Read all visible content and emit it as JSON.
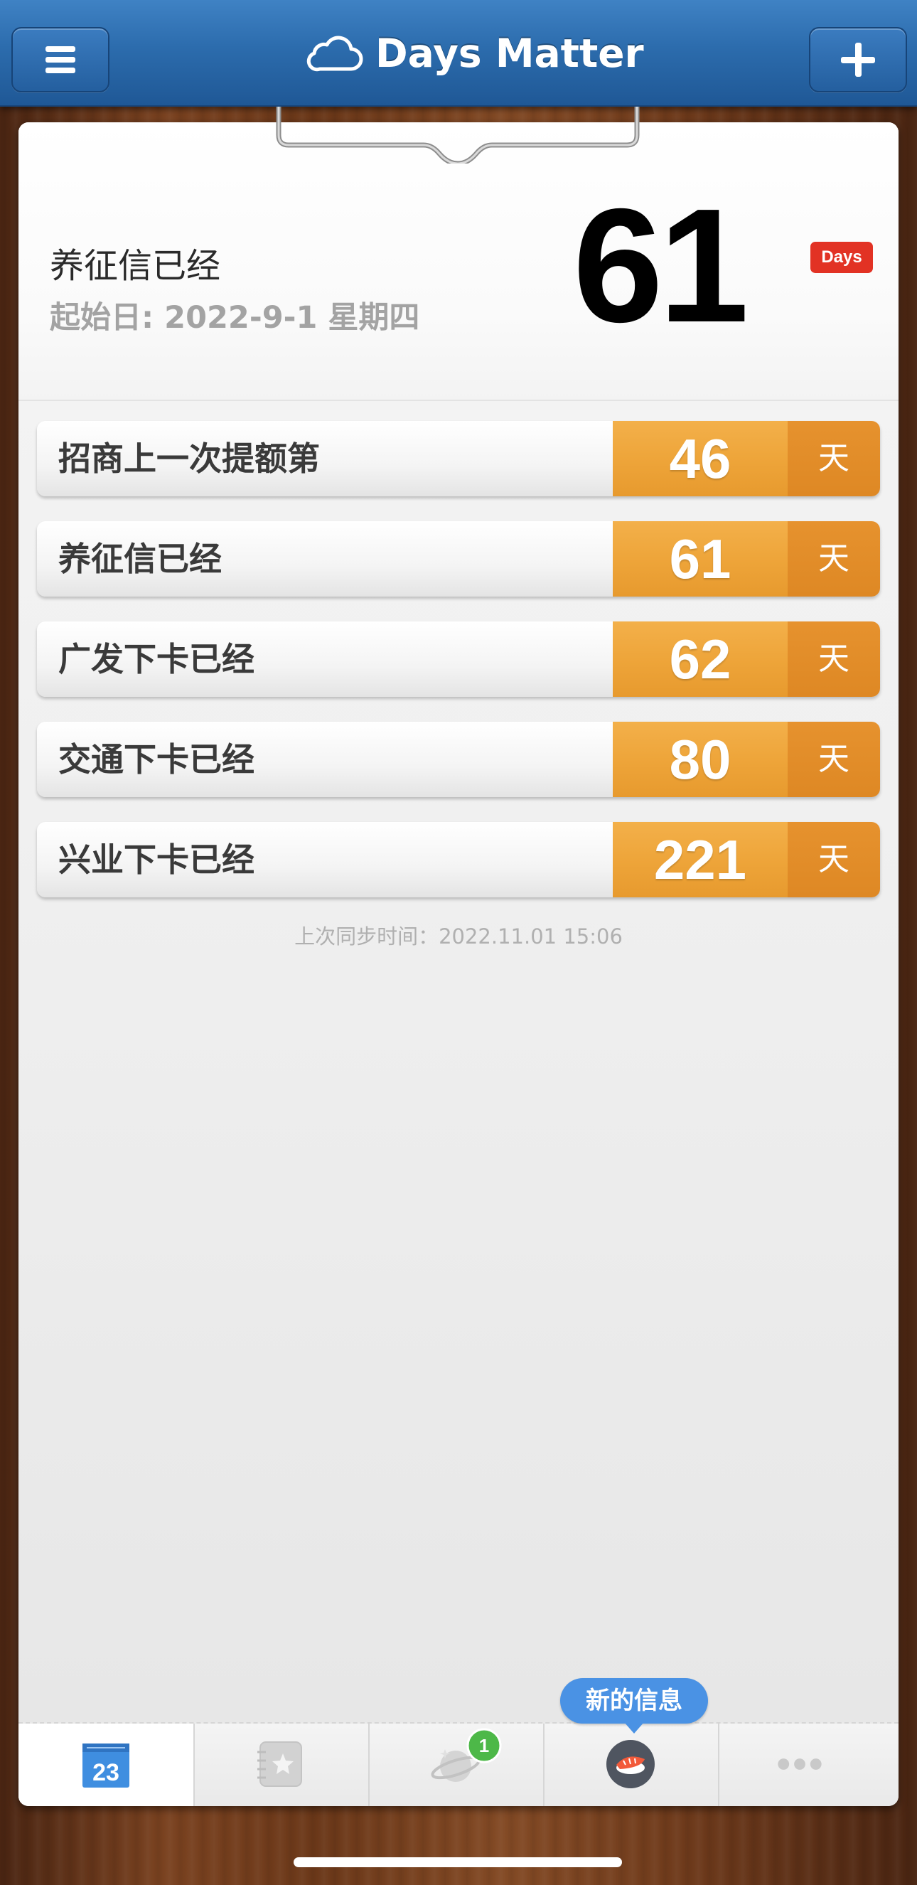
{
  "header": {
    "title": "Days Matter",
    "menu_icon": "hamburger-menu-icon",
    "add_icon": "plus-icon",
    "cloud_icon": "cloud-icon"
  },
  "hero": {
    "title": "养征信已经",
    "start_date": "起始日: 2022-9-1 星期四",
    "days": "61",
    "badge": "Days"
  },
  "events": [
    {
      "name": "招商上一次提额第",
      "days": "46",
      "unit": "天"
    },
    {
      "name": "养征信已经",
      "days": "61",
      "unit": "天"
    },
    {
      "name": "广发下卡已经",
      "days": "62",
      "unit": "天"
    },
    {
      "name": "交通下卡已经",
      "days": "80",
      "unit": "天"
    },
    {
      "name": "兴业下卡已经",
      "days": "221",
      "unit": "天"
    }
  ],
  "sync_text": "上次同步时间：2022.11.01 15:06",
  "tabbar": {
    "tabs": [
      {
        "icon": "calendar-icon",
        "label": "23"
      },
      {
        "icon": "star-notebook-icon"
      },
      {
        "icon": "planet-icon",
        "badge": "1"
      },
      {
        "icon": "sushi-icon"
      },
      {
        "icon": "more-icon"
      }
    ],
    "tooltip": "新的信息"
  },
  "colors": {
    "header_blue": "#2c6cad",
    "accent_orange": "#eea53a",
    "badge_red": "#e23224",
    "tooltip_blue": "#4a92e4",
    "badge_green": "#4db848"
  }
}
